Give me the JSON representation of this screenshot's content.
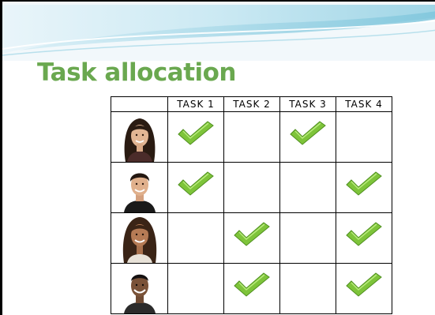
{
  "slide": {
    "title": "Task allocation"
  },
  "table": {
    "headers": [
      "",
      "TASK 1",
      "TASK 2",
      "TASK 3",
      "TASK 4"
    ],
    "rows": [
      {
        "person": "person-1",
        "assignments": [
          true,
          false,
          true,
          false
        ]
      },
      {
        "person": "person-2",
        "assignments": [
          true,
          false,
          false,
          true
        ]
      },
      {
        "person": "person-3",
        "assignments": [
          false,
          true,
          false,
          true
        ]
      },
      {
        "person": "person-4",
        "assignments": [
          false,
          true,
          false,
          true
        ]
      }
    ]
  },
  "colors": {
    "title": "#6aa84f",
    "check": "#7ec43a",
    "wave": "#bfe3ef"
  },
  "icons": {
    "check": "green-checkmark-icon",
    "header": "decorative-wave"
  }
}
